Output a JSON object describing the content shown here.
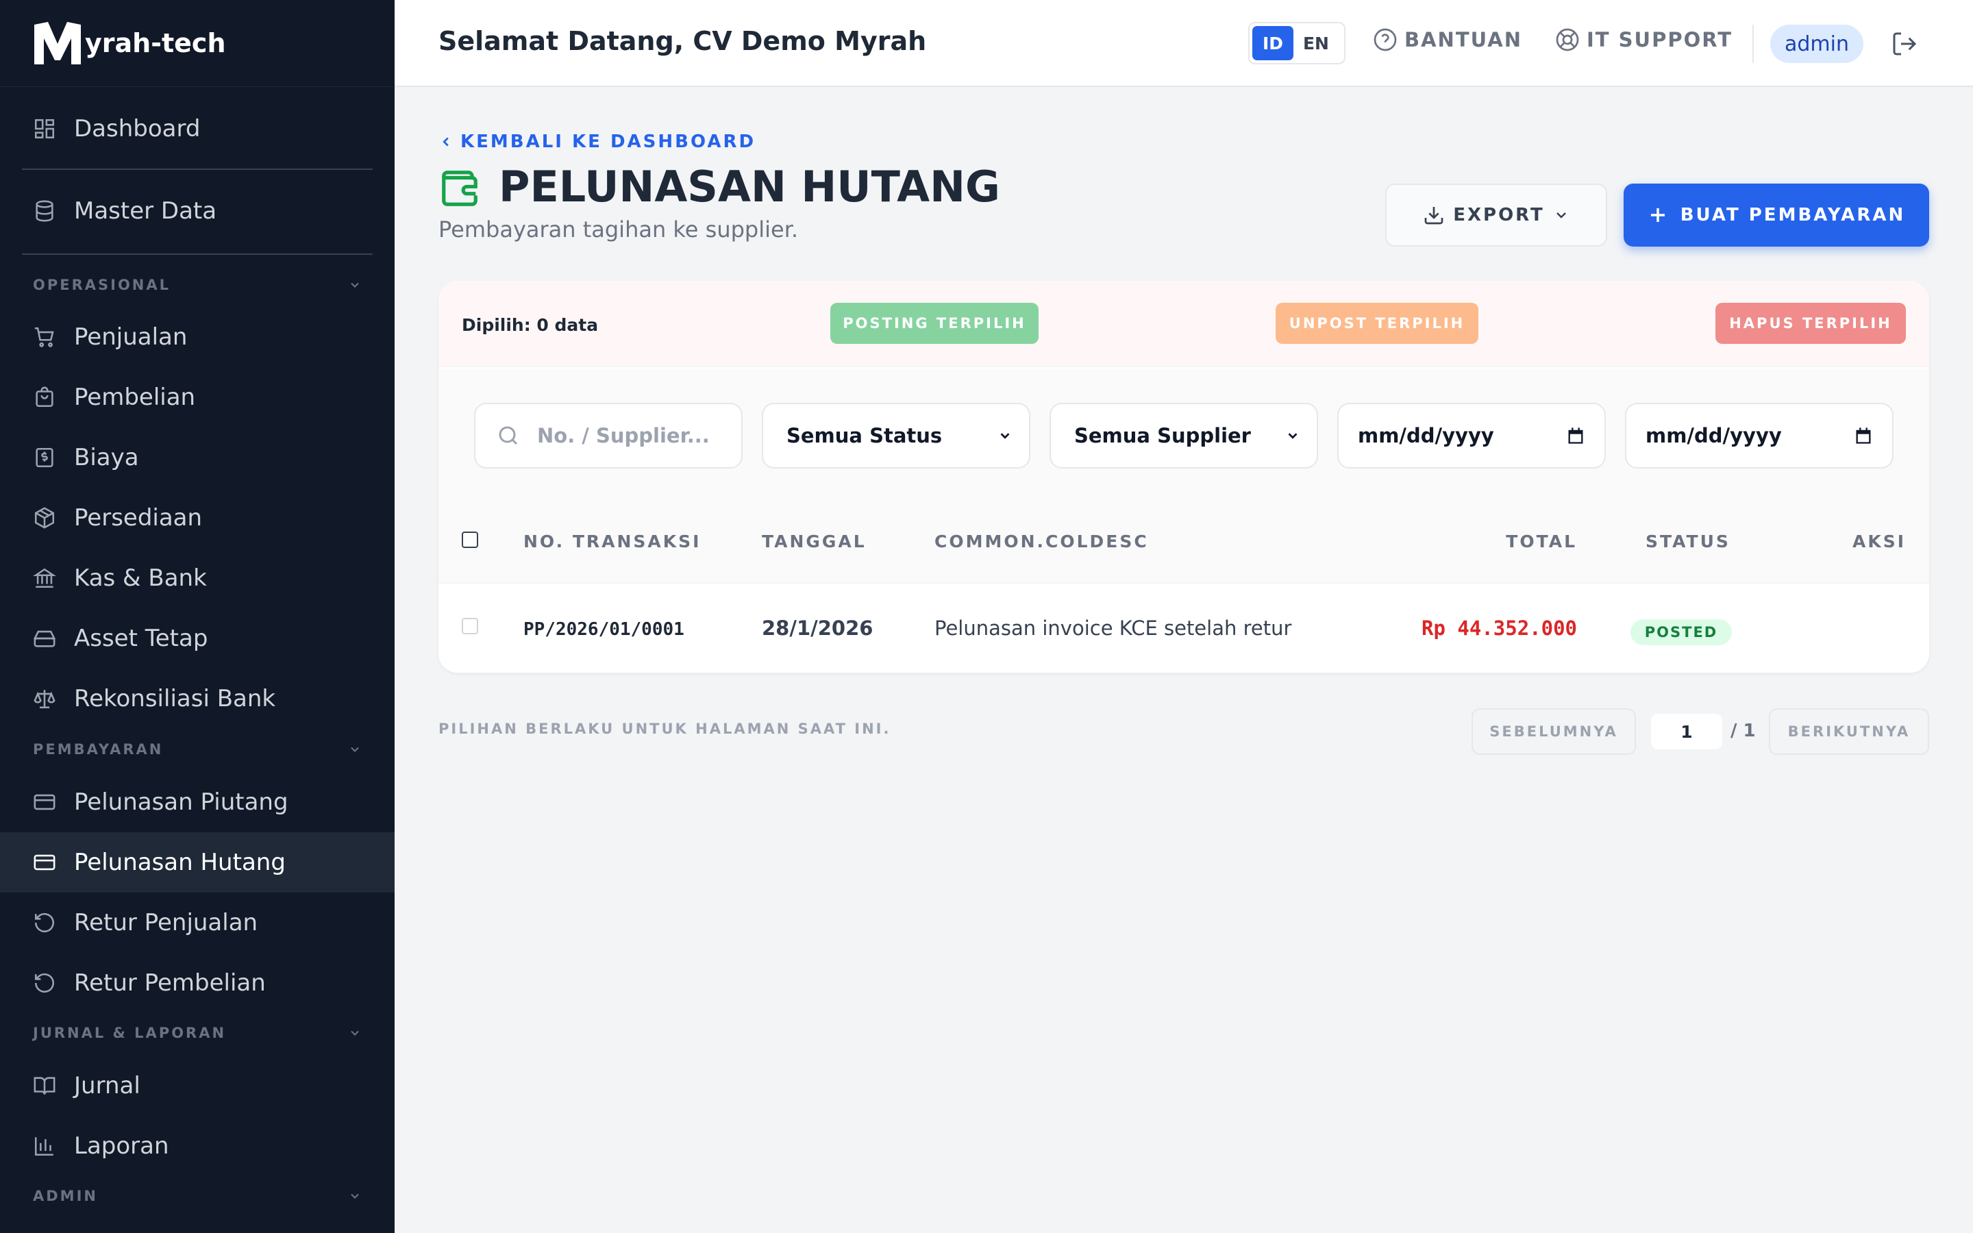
{
  "brand": {
    "logo_letter": "M",
    "name": "yrah-tech"
  },
  "sidebar": {
    "dashboard": "Dashboard",
    "master_data": "Master Data",
    "sections": {
      "operasional": "OPERASIONAL",
      "pembayaran": "PEMBAYARAN",
      "jurnal": "JURNAL & LAPORAN",
      "admin": "ADMIN"
    },
    "items": {
      "penjualan": "Penjualan",
      "pembelian": "Pembelian",
      "biaya": "Biaya",
      "persediaan": "Persediaan",
      "kas_bank": "Kas & Bank",
      "asset_tetap": "Asset Tetap",
      "rekonsiliasi": "Rekonsiliasi Bank",
      "pelunasan_piutang": "Pelunasan Piutang",
      "pelunasan_hutang": "Pelunasan Hutang",
      "retur_penjualan": "Retur Penjualan",
      "retur_pembelian": "Retur Pembelian",
      "jurnal": "Jurnal",
      "laporan": "Laporan"
    },
    "active": "pelunasan_hutang"
  },
  "header": {
    "welcome": "Selamat Datang, CV Demo Myrah",
    "lang_active": "ID",
    "lang_other": "EN",
    "help": "BANTUAN",
    "it_support": "IT SUPPORT",
    "user": "admin"
  },
  "page": {
    "back": "KEMBALI KE DASHBOARD",
    "title": "PELUNASAN HUTANG",
    "subtitle": "Pembayaran tagihan ke supplier.",
    "export": "EXPORT",
    "create": "BUAT PEMBAYARAN"
  },
  "bulk": {
    "selected": "Dipilih: 0 data",
    "post": "POSTING TERPILIH",
    "unpost": "UNPOST TERPILIH",
    "delete": "HAPUS TERPILIH"
  },
  "filters": {
    "search_placeholder": "No. / Supplier...",
    "status": "Semua Status",
    "supplier": "Semua Supplier",
    "date_from": "mm/dd/yyyy",
    "date_to": "mm/dd/yyyy"
  },
  "table": {
    "columns": [
      "NO. TRANSAKSI",
      "TANGGAL",
      "COMMON.COLDESC",
      "TOTAL",
      "STATUS",
      "AKSI"
    ],
    "rows": [
      {
        "no": "PP/2026/01/0001",
        "date": "28/1/2026",
        "desc": "Pelunasan invoice KCE setelah retur",
        "total": "Rp 44.352.000",
        "status": "POSTED"
      }
    ]
  },
  "footer": {
    "note": "PILIHAN BERLAKU UNTUK HALAMAN SAAT INI.",
    "prev": "SEBELUMNYA",
    "page": "1",
    "of": "/ 1",
    "next": "BERIKUTNYA"
  },
  "colors": {
    "primary": "#2563eb",
    "sidebar": "#111827",
    "post": "#86d3a0",
    "unpost": "#fdba8c",
    "delete": "#f08c8c",
    "total": "#dc2626",
    "posted_bg": "#dcfce7"
  }
}
